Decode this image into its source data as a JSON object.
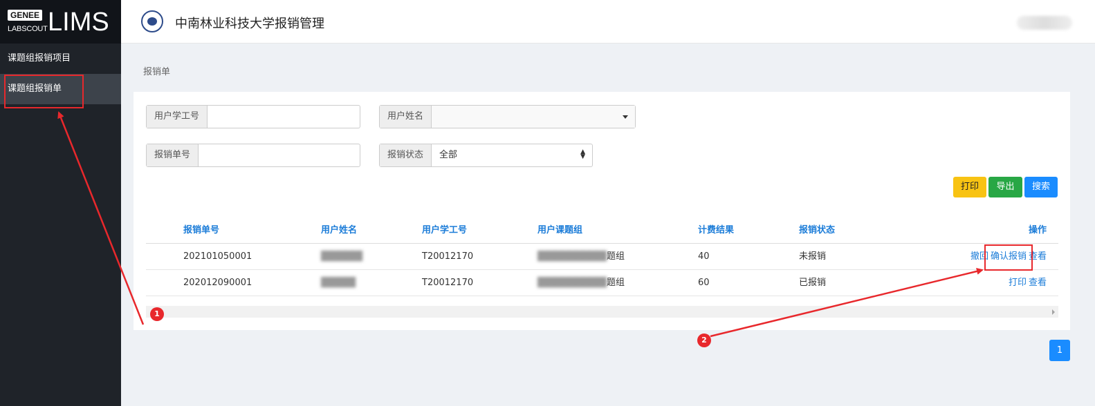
{
  "sidebar": {
    "logo_badge": "GENEE",
    "logo_sub": "LABSCOUT",
    "logo_main": "LIMS",
    "items": [
      {
        "label": "课题组报销项目"
      },
      {
        "label": "课题组报销单",
        "active": true
      }
    ]
  },
  "header": {
    "title": "中南林业科技大学报销管理"
  },
  "breadcrumb": "报销单",
  "filters": {
    "user_id_label": "用户学工号",
    "user_id_value": "",
    "user_name_label": "用户姓名",
    "user_name_value": "",
    "order_no_label": "报销单号",
    "order_no_value": "",
    "status_label": "报销状态",
    "status_value": "全部"
  },
  "buttons": {
    "print": "打印",
    "export": "导出",
    "search": "搜索"
  },
  "table": {
    "headers": [
      "报销单号",
      "用户姓名",
      "用户学工号",
      "用户课题组",
      "计费结果",
      "报销状态",
      "操作"
    ],
    "rows": [
      {
        "order_no": "202101050001",
        "name": "██████",
        "user_id": "T20012170",
        "group_prefix": "██████████",
        "group_suffix": "题组",
        "fee": "40",
        "status": "未报销",
        "actions": [
          "撤回",
          "确认报销",
          "查看"
        ]
      },
      {
        "order_no": "202012090001",
        "name": "█████",
        "user_id": "T20012170",
        "group_prefix": "██████████",
        "group_suffix": "题组",
        "fee": "60",
        "status": "已报销",
        "actions": [
          "打印",
          "查看"
        ]
      }
    ]
  },
  "pagination": {
    "current": "1"
  },
  "annotations": {
    "marker1": "1",
    "marker2": "2",
    "color": "#e8282c"
  }
}
